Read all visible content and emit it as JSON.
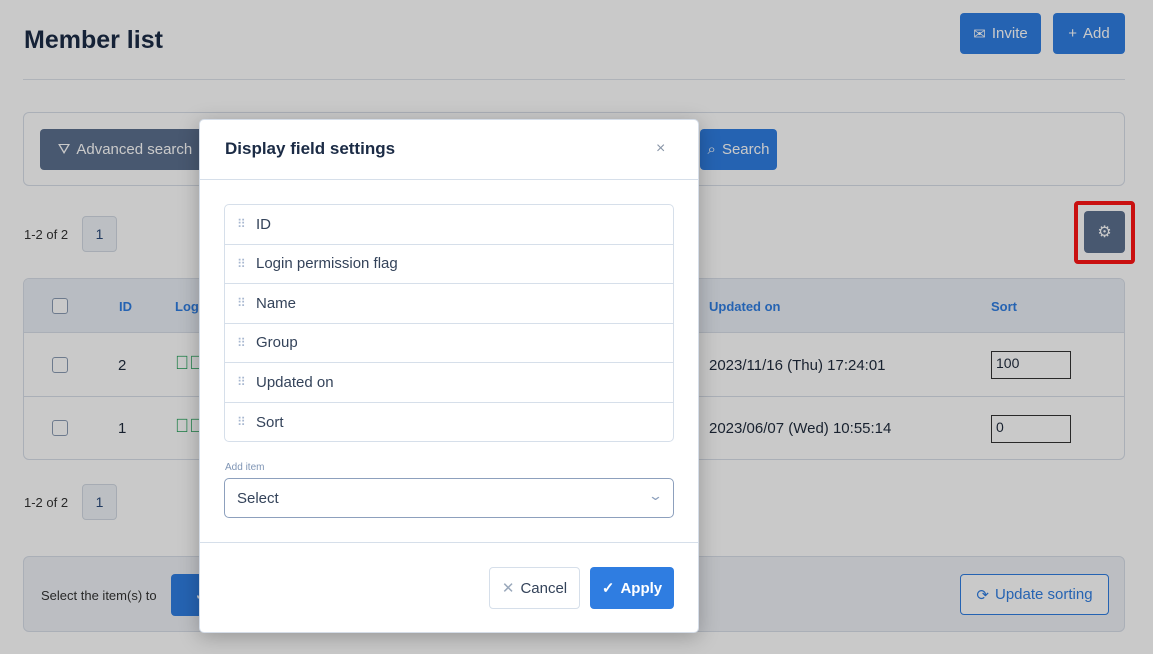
{
  "header": {
    "title": "Member list",
    "invite_label": "Invite",
    "add_label": "Add"
  },
  "search": {
    "advanced_label": "Advanced search",
    "search_label": "Search"
  },
  "pagination": {
    "range_text": "1-2 of 2",
    "current_page": "1"
  },
  "table": {
    "columns": [
      "ID",
      "Logi",
      "Updated on",
      "Sort"
    ],
    "rows": [
      {
        "id": "2",
        "login": "check",
        "updated_on": "2023/11/16 (Thu) 17:24:01",
        "sort": "100"
      },
      {
        "id": "1",
        "login": "check",
        "updated_on": "2023/06/07 (Wed) 10:55:14",
        "sort": "0"
      }
    ]
  },
  "bulk": {
    "text": "Select the item(s) to",
    "update_sorting_label": "Update sorting"
  },
  "modal": {
    "title": "Display field settings",
    "fields": [
      "ID",
      "Login permission flag",
      "Name",
      "Group",
      "Updated on",
      "Sort"
    ],
    "add_item_label": "Add item",
    "select_value": "Select",
    "cancel_label": "Cancel",
    "apply_label": "Apply"
  },
  "colors": {
    "primary": "#2f7de1",
    "highlight": "#e01010",
    "success": "#1f9d55"
  }
}
